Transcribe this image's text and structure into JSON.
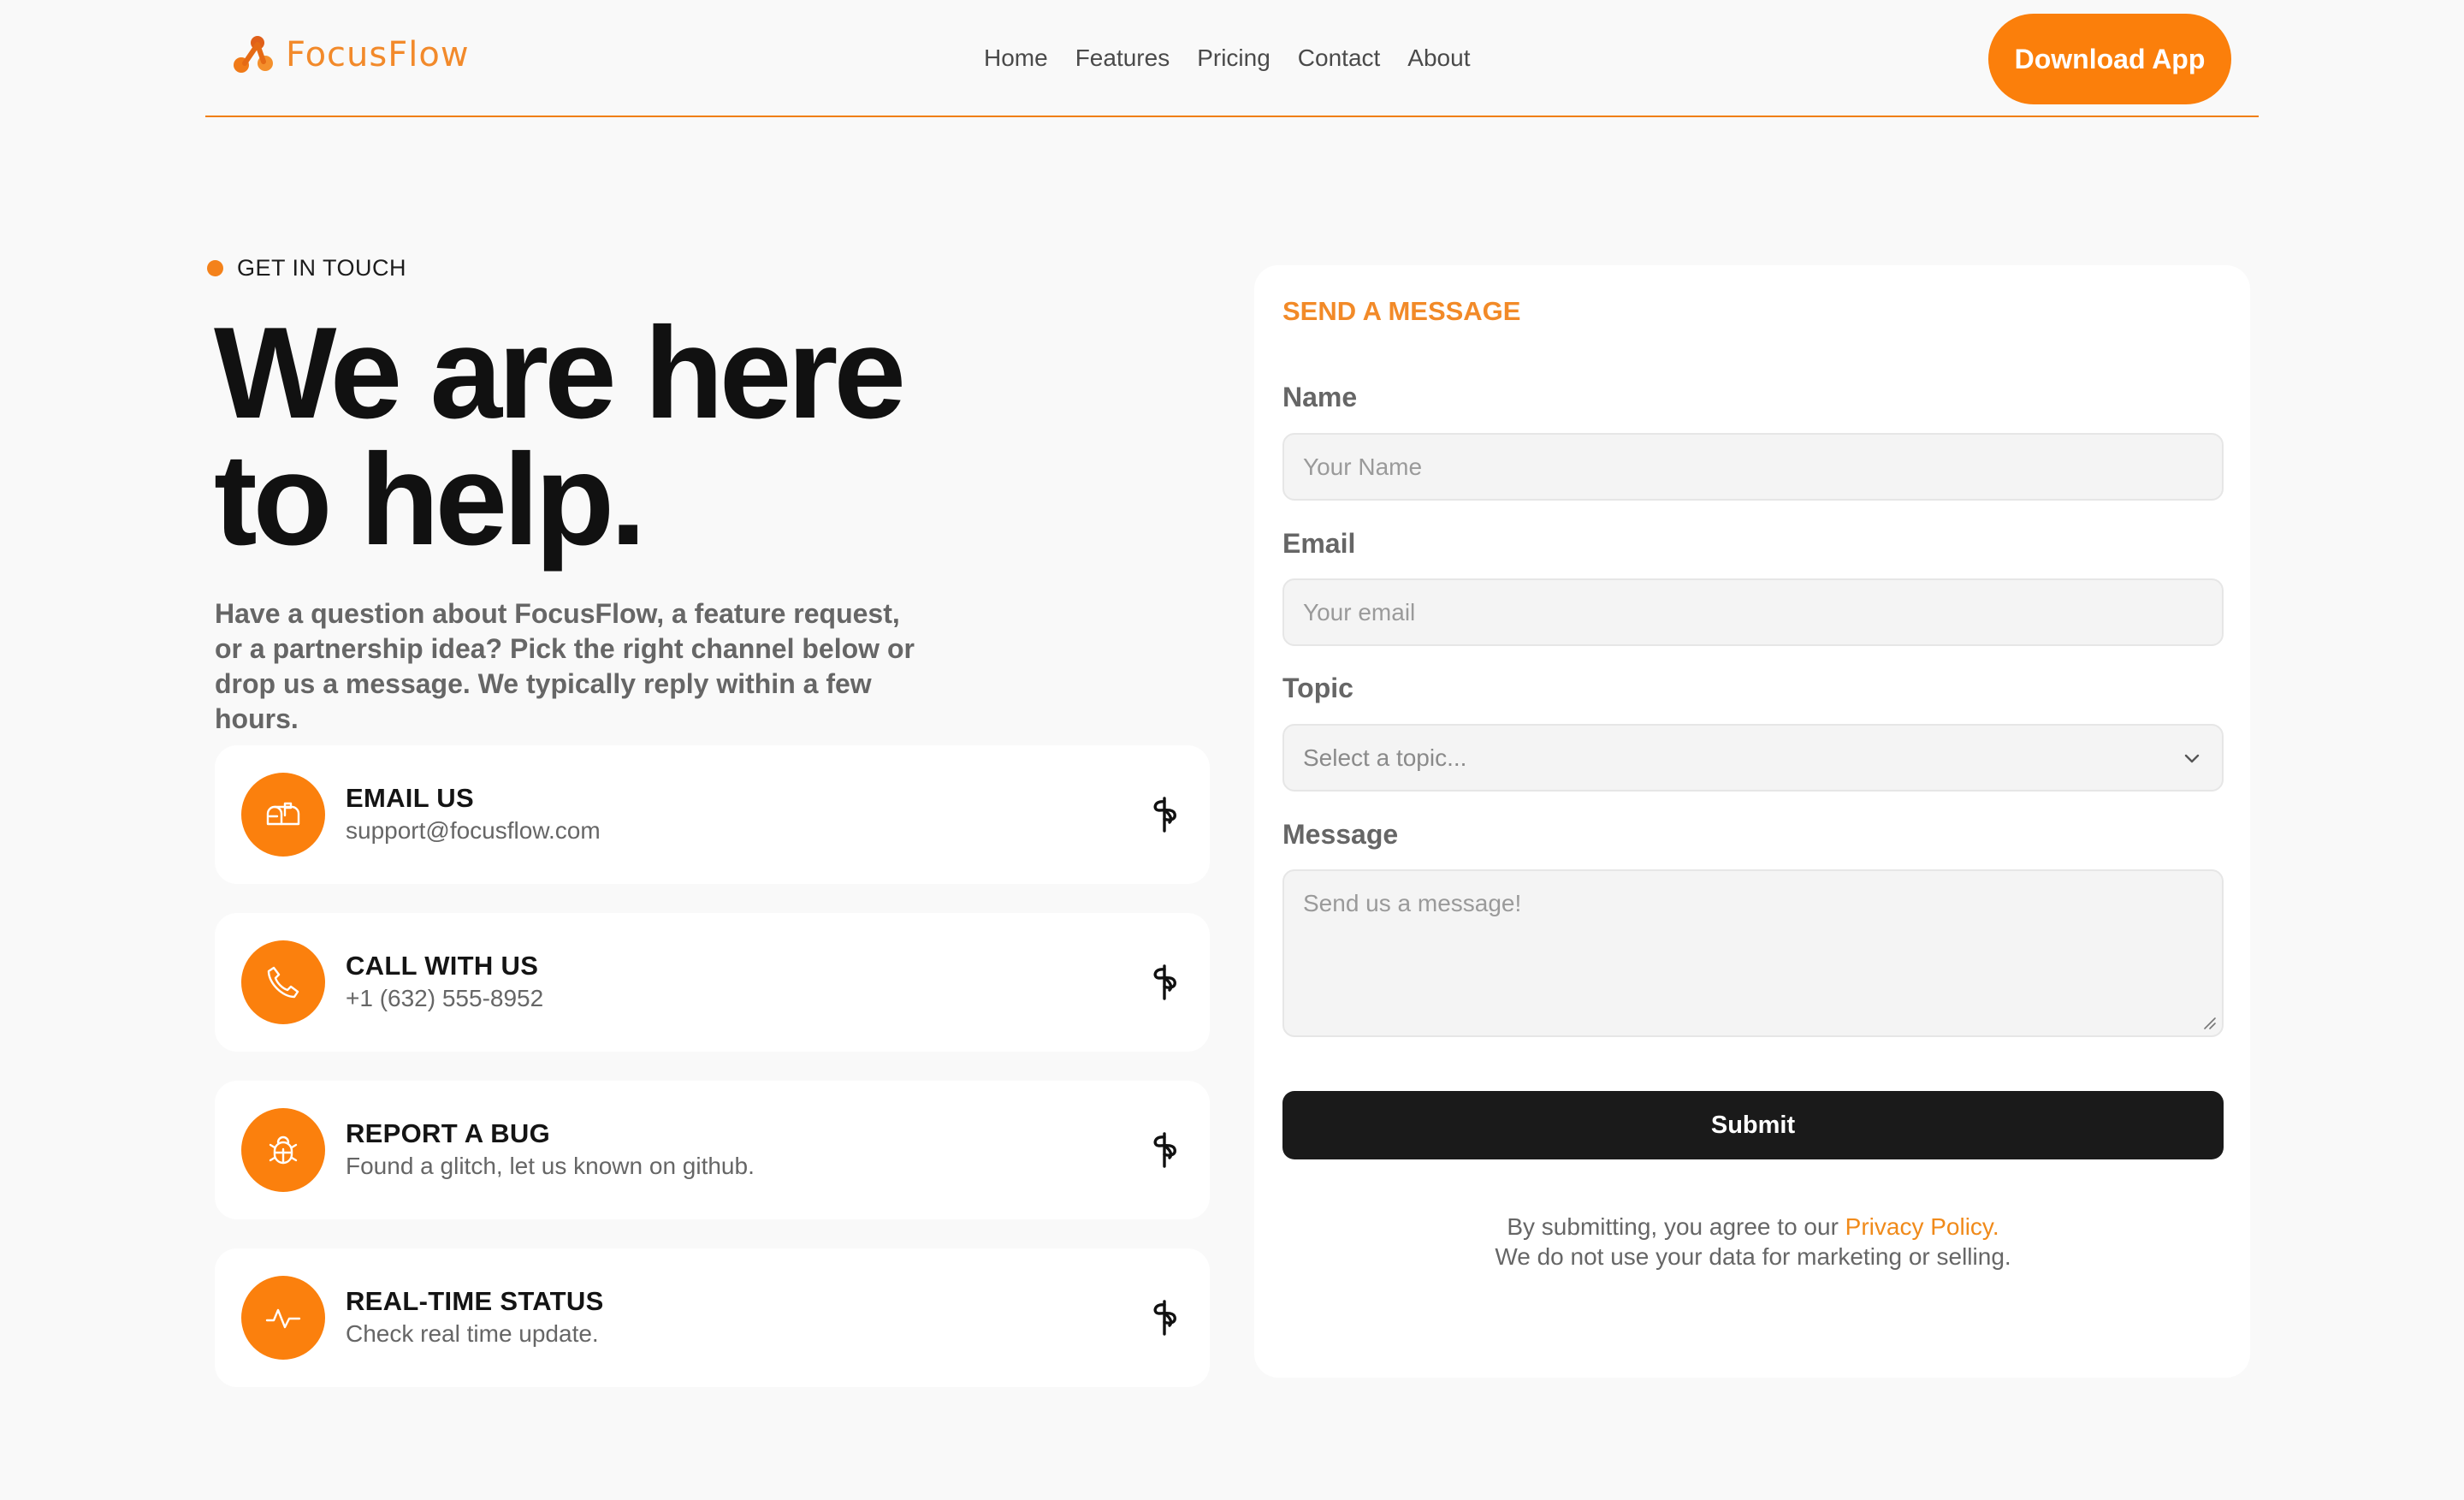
{
  "brand": {
    "name": "FocusFlow",
    "accent": "#fb800d"
  },
  "nav": {
    "items": [
      "Home",
      "Features",
      "Pricing",
      "Contact",
      "About"
    ],
    "cta_label": "Download App"
  },
  "hero": {
    "eyebrow": "GET IN TOUCH",
    "title_line1": "We are here",
    "title_line2": "to help.",
    "description": "Have a question about FocusFlow, a feature request, or a partnership idea? Pick the right channel below or drop us a message. We typically reply within a few hours."
  },
  "channels": [
    {
      "title": "EMAIL US",
      "subtitle": "support@focusflow.com",
      "icon": "mailbox-icon"
    },
    {
      "title": "CALL WITH US",
      "subtitle": "+1 (632) 555-8952",
      "icon": "phone-icon"
    },
    {
      "title": "REPORT A BUG",
      "subtitle": "Found a glitch, let us known on github.",
      "icon": "bug-icon"
    },
    {
      "title": "REAL-TIME STATUS",
      "subtitle": "Check real time update.",
      "icon": "activity-icon"
    }
  ],
  "form": {
    "heading": "SEND A MESSAGE",
    "name": {
      "label": "Name",
      "placeholder": "Your Name",
      "value": ""
    },
    "email": {
      "label": "Email",
      "placeholder": "Your email",
      "value": ""
    },
    "topic": {
      "label": "Topic",
      "selected": "Select a topic..."
    },
    "message": {
      "label": "Message",
      "placeholder": "Send us a message!",
      "value": ""
    },
    "submit_label": "Submit",
    "legal_prefix": "By submitting, you agree to our ",
    "legal_link": "Privacy Policy.",
    "legal_line2": "We do not use your data for marketing or selling."
  }
}
